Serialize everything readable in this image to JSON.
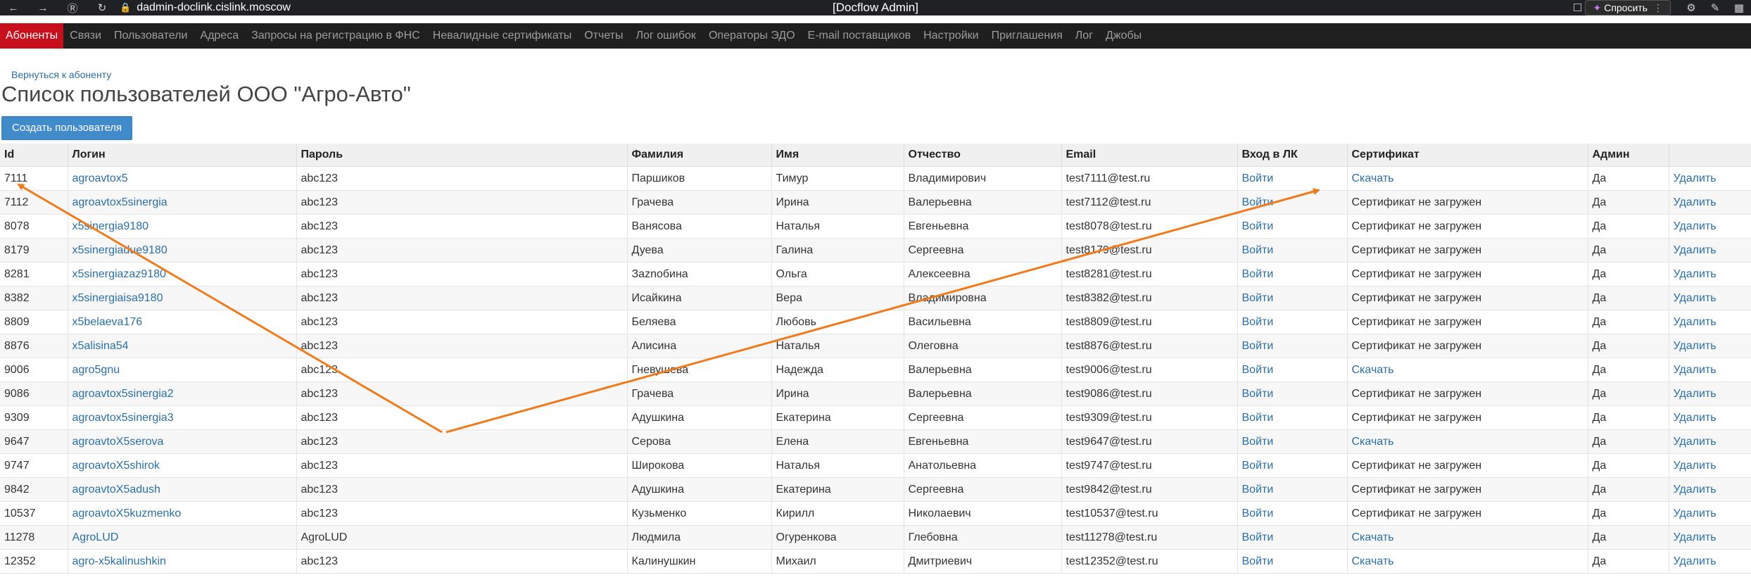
{
  "browser": {
    "url": "dadmin-doclink.cislink.moscow",
    "window_title": "[Docflow Admin]",
    "ask_label": "Спросить"
  },
  "nav": [
    {
      "label": "Абоненты",
      "active": true
    },
    {
      "label": "Связи"
    },
    {
      "label": "Пользователи"
    },
    {
      "label": "Адреса"
    },
    {
      "label": "Запросы на регистрацию в ФНС"
    },
    {
      "label": "Невалидные сертификаты"
    },
    {
      "label": "Отчеты"
    },
    {
      "label": "Лог ошибок"
    },
    {
      "label": "Операторы ЭДО"
    },
    {
      "label": "E-mail поставщиков"
    },
    {
      "label": "Настройки"
    },
    {
      "label": "Приглашения"
    },
    {
      "label": "Лог"
    },
    {
      "label": "Джобы"
    }
  ],
  "back_link": "Вернуться к абоненту",
  "page_title": "Список пользователей ООО \"Агро-Авто\"",
  "create_button": "Создать пользователя",
  "table": {
    "headers": [
      "Id",
      "Логин",
      "Пароль",
      "Фамилия",
      "Имя",
      "Отчество",
      "Email",
      "Вход в ЛК",
      "Сертификат",
      "Админ",
      ""
    ],
    "rows": [
      {
        "id": "7111",
        "login": "agroavtox5",
        "password": "abc123",
        "last": "Паршиков",
        "first": "Тимур",
        "middle": "Владимирович",
        "email": "test7111@test.ru",
        "enter": "Войти",
        "cert": "Скачать",
        "cert_link": true,
        "admin": "Да",
        "del": "Удалить"
      },
      {
        "id": "7112",
        "login": "agroavtox5sinergia",
        "password": "abc123",
        "last": "Грачева",
        "first": "Ирина",
        "middle": "Валерьевна",
        "email": "test7112@test.ru",
        "enter": "Войти",
        "cert": "Сертификат не загружен",
        "cert_link": false,
        "admin": "Да",
        "del": "Удалить"
      },
      {
        "id": "8078",
        "login": "x5sinergia9180",
        "password": "abc123",
        "last": "Ванясова",
        "first": "Наталья",
        "middle": "Евгеньевна",
        "email": "test8078@test.ru",
        "enter": "Войти",
        "cert": "Сертификат не загружен",
        "cert_link": false,
        "admin": "Да",
        "del": "Удалить"
      },
      {
        "id": "8179",
        "login": "x5sinergiadue9180",
        "password": "abc123",
        "last": "Дуева",
        "first": "Галина",
        "middle": "Сергеевна",
        "email": "test8179@test.ru",
        "enter": "Войти",
        "cert": "Сертификат не загружен",
        "cert_link": false,
        "admin": "Да",
        "del": "Удалить"
      },
      {
        "id": "8281",
        "login": "x5sinergiazaz9180",
        "password": "abc123",
        "last": "Заznобина",
        "first": "Ольга",
        "middle": "Алексеевна",
        "email": "test8281@test.ru",
        "enter": "Войти",
        "cert": "Сертификат не загружен",
        "cert_link": false,
        "admin": "Да",
        "del": "Удалить"
      },
      {
        "id": "8382",
        "login": "x5sinergiaisa9180",
        "password": "abc123",
        "last": "Исайкина",
        "first": "Вера",
        "middle": "Владимировна",
        "email": "test8382@test.ru",
        "enter": "Войти",
        "cert": "Сертификат не загружен",
        "cert_link": false,
        "admin": "Да",
        "del": "Удалить"
      },
      {
        "id": "8809",
        "login": "x5belaeva176",
        "password": "abc123",
        "last": "Беляева",
        "first": "Любовь",
        "middle": "Васильевна",
        "email": "test8809@test.ru",
        "enter": "Войти",
        "cert": "Сертификат не загружен",
        "cert_link": false,
        "admin": "Да",
        "del": "Удалить"
      },
      {
        "id": "8876",
        "login": "x5alisina54",
        "password": "abc123",
        "last": "Алисина",
        "first": "Наталья",
        "middle": "Олеговна",
        "email": "test8876@test.ru",
        "enter": "Войти",
        "cert": "Сертификат не загружен",
        "cert_link": false,
        "admin": "Да",
        "del": "Удалить"
      },
      {
        "id": "9006",
        "login": "agro5gnu",
        "password": "abc123",
        "last": "Гневушева",
        "first": "Надежда",
        "middle": "Валерьевна",
        "email": "test9006@test.ru",
        "enter": "Войти",
        "cert": "Скачать",
        "cert_link": true,
        "admin": "Да",
        "del": "Удалить"
      },
      {
        "id": "9086",
        "login": "agroavtox5sinergia2",
        "password": "abc123",
        "last": "Грачева",
        "first": "Ирина",
        "middle": "Валерьевна",
        "email": "test9086@test.ru",
        "enter": "Войти",
        "cert": "Сертификат не загружен",
        "cert_link": false,
        "admin": "Да",
        "del": "Удалить"
      },
      {
        "id": "9309",
        "login": "agroavtox5sinergia3",
        "password": "abc123",
        "last": "Адушкина",
        "first": "Екатерина",
        "middle": "Сергеевна",
        "email": "test9309@test.ru",
        "enter": "Войти",
        "cert": "Сертификат не загружен",
        "cert_link": false,
        "admin": "Да",
        "del": "Удалить"
      },
      {
        "id": "9647",
        "login": "agroavtoX5serova",
        "password": "abc123",
        "last": "Серова",
        "first": "Елена",
        "middle": "Евгеньевна",
        "email": "test9647@test.ru",
        "enter": "Войти",
        "cert": "Скачать",
        "cert_link": true,
        "admin": "Да",
        "del": "Удалить"
      },
      {
        "id": "9747",
        "login": "agroavtoX5shirok",
        "password": "abc123",
        "last": "Широкова",
        "first": "Наталья",
        "middle": "Анатольевна",
        "email": "test9747@test.ru",
        "enter": "Войти",
        "cert": "Сертификат не загружен",
        "cert_link": false,
        "admin": "Да",
        "del": "Удалить"
      },
      {
        "id": "9842",
        "login": "agroavtoX5adush",
        "password": "abc123",
        "last": "Адушкина",
        "first": "Екатерина",
        "middle": "Сергеевна",
        "email": "test9842@test.ru",
        "enter": "Войти",
        "cert": "Сертификат не загружен",
        "cert_link": false,
        "admin": "Да",
        "del": "Удалить"
      },
      {
        "id": "10537",
        "login": "agroavtoX5kuzmenko",
        "password": "abc123",
        "last": "Кузьменко",
        "first": "Кирилл",
        "middle": "Николаевич",
        "email": "test10537@test.ru",
        "enter": "Войти",
        "cert": "Сертификат не загружен",
        "cert_link": false,
        "admin": "Да",
        "del": "Удалить"
      },
      {
        "id": "11278",
        "login": "AgroLUD",
        "password": "AgroLUD",
        "last": "Людмила",
        "first": "Огуренкова",
        "middle": "Глебовна",
        "email": "test11278@test.ru",
        "enter": "Войти",
        "cert": "Скачать",
        "cert_link": true,
        "admin": "Да",
        "del": "Удалить"
      },
      {
        "id": "12352",
        "login": "agro-x5kalinushkin",
        "password": "abc123",
        "last": "Калинушкин",
        "first": "Михаил",
        "middle": "Дмитриевич",
        "email": "test12352@test.ru",
        "enter": "Войти",
        "cert": "Скачать",
        "cert_link": true,
        "admin": "Да",
        "del": "Удалить"
      }
    ]
  },
  "colors": {
    "nav_bg": "#1f1f1f",
    "nav_active": "#c8101d",
    "link": "#2a6fa8",
    "button": "#428bca",
    "annotation": "#f07b1a"
  }
}
